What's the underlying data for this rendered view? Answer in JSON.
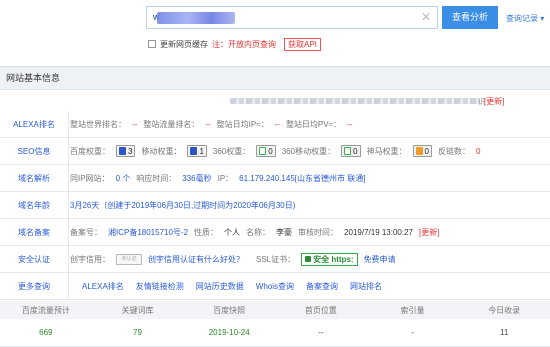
{
  "search": {
    "value": "w",
    "search_label": "查看分析",
    "record_label": "查询记录"
  },
  "options": {
    "update_cache": "更新网页缓存",
    "note": "注：开放内页查询",
    "api": "获取API"
  },
  "section_title": "网站基本信息",
  "desc_tail": "识",
  "desc_update": "[更新]",
  "alexa": {
    "label": "ALEXA排名",
    "world_k": "整站世界排名：",
    "world_v": "--",
    "traffic_k": "整站流量排名：",
    "traffic_v": "--",
    "ip_k": "整站日均IP≈：",
    "ip_v": "--",
    "pv_k": "整站日均PV≈：",
    "pv_v": "--"
  },
  "seo": {
    "label": "SEO信息",
    "baidu_k": "百度权重：",
    "baidu_v": "3",
    "mobile_k": "移动权重：",
    "mobile_v": "1",
    "s360_k": "360权重：",
    "s360_v": "0",
    "s360m_k": "360移动权重：",
    "s360m_v": "0",
    "shenma_k": "神马权重：",
    "shenma_v": "0",
    "backlink_k": "反链数：",
    "backlink_v": "0"
  },
  "dns": {
    "label": "域名解析",
    "sameip_k": "同IP网站：",
    "sameip_v": "0 个",
    "resp_k": "响应时间：",
    "resp_v": "336毫秒",
    "ip_k": "IP：",
    "ip_v": "61.179.240.145[山东省德州市 联通]"
  },
  "age": {
    "label": "域名年龄",
    "value": "3月26天（创建于2019年06月30日,过期时间为2020年06月30日)"
  },
  "icp": {
    "label": "域名备案",
    "no_k": "备案号：",
    "no_v": "湘ICP备18015710号-2",
    "type_k": "性质：",
    "type_v": "个人",
    "name_k": "名称：",
    "name_v": "李豪",
    "time_k": "审核时间：",
    "time_v": "2019/7/19 13:00:27",
    "update": "[更新]"
  },
  "security": {
    "label": "安全认证",
    "trust_k": "创宇信用：",
    "trust_box": "未认证",
    "trust_link": "创宇信用认证有什么好处？",
    "ssl_k": "SSL证书：",
    "ssl_badge": "安全 https:",
    "ssl_apply": "免费申请"
  },
  "more": {
    "label": "更多查询",
    "links": [
      "ALEXA排名",
      "友情链接检测",
      "网站历史数据",
      "Whois查询",
      "备案查询",
      "网站排名"
    ]
  },
  "table": {
    "headers": [
      "百度流量预计",
      "关键词库",
      "百度快照",
      "首页位置",
      "索引量",
      "今日收录"
    ],
    "values": [
      "669",
      "79",
      "2019-10-24",
      "--",
      "-",
      "11"
    ]
  },
  "colors": {
    "accent": "#3a8ee6",
    "link": "#2a5bd7",
    "alert": "#e33333"
  }
}
